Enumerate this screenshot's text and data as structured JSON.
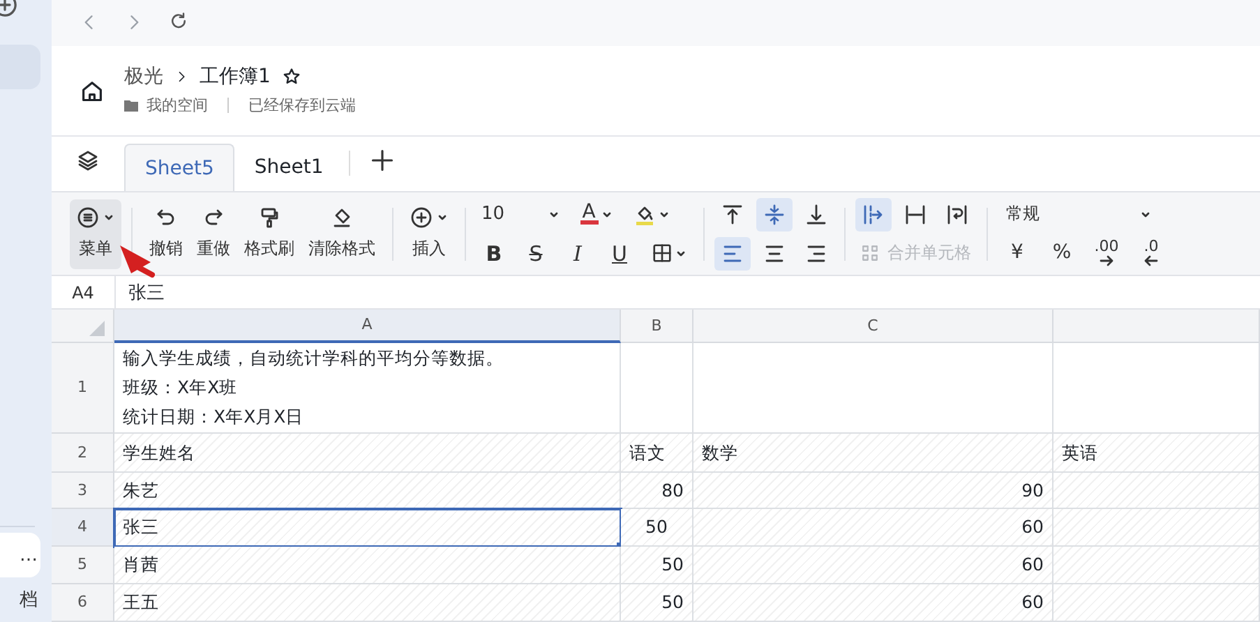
{
  "sidebar": {
    "items": [
      {
        "label": "…",
        "selected": true
      },
      {
        "label": "档",
        "selected": false
      }
    ]
  },
  "header": {
    "breadcrumb": [
      "极光",
      "工作簿1"
    ],
    "location": "我的空间",
    "status": "已经保存到云端"
  },
  "tabs": [
    {
      "label": "Sheet5",
      "selected": true
    },
    {
      "label": "Sheet1",
      "selected": false
    }
  ],
  "toolbar": {
    "actions": [
      {
        "kind": "menu",
        "label": "菜单",
        "pressed": true,
        "caret": true
      },
      {
        "kind": "undo",
        "label": "撤销",
        "pressed": false,
        "caret": false
      },
      {
        "kind": "redo",
        "label": "重做",
        "pressed": false,
        "caret": false
      },
      {
        "kind": "painter",
        "label": "格式刷",
        "pressed": false,
        "caret": false
      },
      {
        "kind": "eraser",
        "label": "清除格式",
        "pressed": false,
        "caret": false
      },
      {
        "kind": "insert",
        "label": "插入",
        "pressed": false,
        "caret": true
      }
    ],
    "font_size": "10",
    "font_color": "A",
    "text_styles": [
      {
        "kind": "bold",
        "label": "B"
      },
      {
        "kind": "strike",
        "label": "S"
      },
      {
        "kind": "italic",
        "label": "I"
      },
      {
        "kind": "underline",
        "label": "U"
      }
    ],
    "vertical_align": [
      {
        "kind": "top",
        "selected": false
      },
      {
        "kind": "middle",
        "selected": true
      },
      {
        "kind": "bottom",
        "selected": false
      }
    ],
    "horizontal_align": [
      {
        "kind": "left",
        "selected": true
      },
      {
        "kind": "center",
        "selected": false
      },
      {
        "kind": "right",
        "selected": false
      }
    ],
    "wrap": [
      {
        "kind": "overflow",
        "selected": true
      },
      {
        "kind": "clip",
        "selected": false
      },
      {
        "kind": "wrap",
        "selected": false
      }
    ],
    "merge": {
      "label": "合并单元格",
      "disabled": true
    },
    "number_format": "常规",
    "number_buttons": [
      {
        "kind": "currency",
        "label": "¥"
      },
      {
        "kind": "percent",
        "label": "%"
      },
      {
        "kind": "add_decimal",
        "label": ".00"
      },
      {
        "kind": "remove_decimal",
        "label": ".0"
      }
    ]
  },
  "formula_bar": {
    "cell": "A4",
    "value": "张三"
  },
  "sheet": {
    "columns": [
      "A",
      "B",
      "C"
    ],
    "rows": [
      {
        "number": "1",
        "selected": false,
        "cells": [
          {
            "kind": "text",
            "lines": [
              "输入学生成绩，自动统计学科的平均分等数据。",
              "班级：X年X班",
              "统计日期：X年X月X日"
            ],
            "selected": false
          },
          {
            "kind": "empty",
            "selected": false
          },
          {
            "kind": "empty",
            "selected": false
          },
          {
            "kind": "empty",
            "selected": false
          }
        ]
      },
      {
        "number": "2",
        "selected": false,
        "cells": [
          {
            "kind": "text",
            "lines": [
              "学生姓名"
            ],
            "selected": false
          },
          {
            "kind": "text",
            "lines": [
              "语文"
            ],
            "selected": false
          },
          {
            "kind": "text",
            "lines": [
              "数学"
            ],
            "selected": false
          },
          {
            "kind": "text",
            "lines": [
              "英语"
            ],
            "selected": false
          }
        ]
      },
      {
        "number": "3",
        "selected": false,
        "cells": [
          {
            "kind": "text",
            "lines": [
              "朱艺"
            ],
            "selected": false
          },
          {
            "kind": "number",
            "lines": [
              "80"
            ],
            "selected": false
          },
          {
            "kind": "number",
            "lines": [
              "90"
            ],
            "selected": false
          },
          {
            "kind": "empty",
            "selected": false
          }
        ]
      },
      {
        "number": "4",
        "selected": true,
        "cells": [
          {
            "kind": "text",
            "lines": [
              "张三"
            ],
            "selected": true
          },
          {
            "kind": "centered",
            "lines": [
              "50"
            ],
            "selected": false
          },
          {
            "kind": "number",
            "lines": [
              "60"
            ],
            "selected": false
          },
          {
            "kind": "empty",
            "selected": false
          }
        ]
      },
      {
        "number": "5",
        "selected": false,
        "cells": [
          {
            "kind": "text",
            "lines": [
              "肖茜"
            ],
            "selected": false
          },
          {
            "kind": "number",
            "lines": [
              "50"
            ],
            "selected": false
          },
          {
            "kind": "number",
            "lines": [
              "60"
            ],
            "selected": false
          },
          {
            "kind": "empty",
            "selected": false
          }
        ]
      },
      {
        "number": "6",
        "selected": false,
        "cells": [
          {
            "kind": "text",
            "lines": [
              "王五"
            ],
            "selected": false
          },
          {
            "kind": "number",
            "lines": [
              "50"
            ],
            "selected": false
          },
          {
            "kind": "number",
            "lines": [
              "60"
            ],
            "selected": false
          },
          {
            "kind": "empty",
            "selected": false
          }
        ]
      }
    ]
  }
}
